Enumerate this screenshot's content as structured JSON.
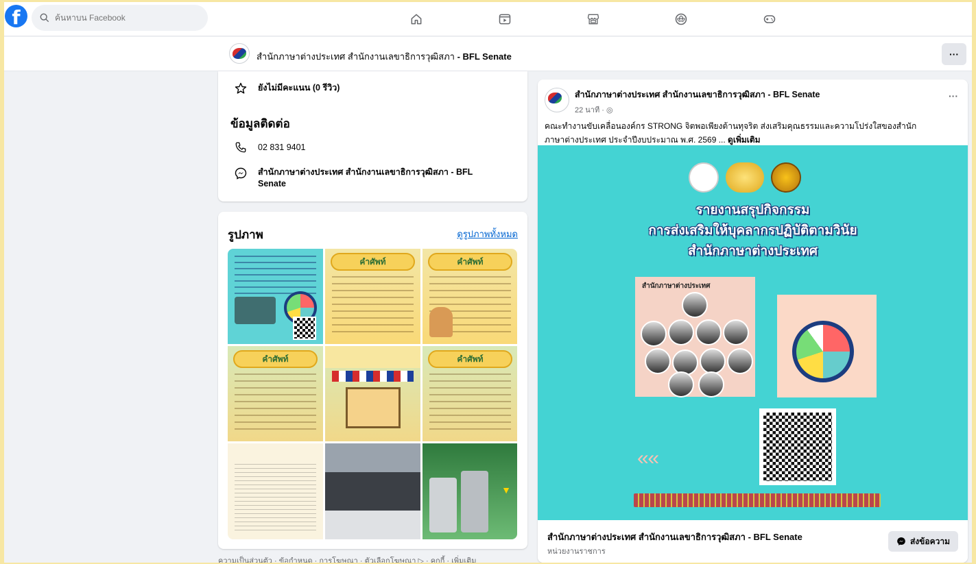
{
  "topbar": {
    "search_placeholder": "ค้นหาบน Facebook",
    "nav_icons": [
      "home-icon",
      "video-icon",
      "marketplace-icon",
      "groups-icon",
      "gaming-icon"
    ]
  },
  "pagebar": {
    "title_thai": "สำนักภาษาต่างประเทศ สำนักงานเลขาธิการวุฒิสภา",
    "title_en": " - BFL Senate",
    "more_label": "···"
  },
  "info": {
    "rating": "ยังไม่มีคะแนน (0 รีวิว)",
    "contact_title": "ข้อมูลติดต่อ",
    "phone": "02 831 9401",
    "messenger_line1": "สำนักภาษาต่างประเทศ สำนักงานเลขาธิการวุฒิสภา - BFL",
    "messenger_line2": "Senate"
  },
  "photos": {
    "title": "รูปภาพ",
    "see_all": "ดูรูปภาพทั้งหมด",
    "tile_banner": "คำศัพท์"
  },
  "footer_links": "ความเป็นส่วนตัว · ข้อกำหนด · การโฆษณา · ตัวเลือกโฆษณา ▷ · คุกกี้ · เพิ่มเติม",
  "post": {
    "author": "สำนักภาษาต่างประเทศ สำนักงานเลขาธิการวุฒิสภา - BFL Senate",
    "time": "22 นาที · ",
    "more_label": "···",
    "text_line1": "คณะทำงานขับเคลื่อนองค์กร STRONG จิตพอเพียงต้านทุจริต ส่งเสริมคุณธรรมและความโปร่งใสของสำนัก",
    "text_line2": "ภาษาต่างประเทศ ประจำปีงบประมาณ พ.ศ. 2569 ... ",
    "see_more": "ดูเพิ่มเติม",
    "image_title_1": "รายงานสรุปกิจกรรม",
    "image_title_2": "การส่งเสริมให้บุคลากรปฏิบัติตามวินัย",
    "image_title_3": "สำนักภาษาต่างประเทศ",
    "image_box_label": "สำนักภาษาต่างประเทศ",
    "page_name": "สำนักภาษาต่างประเทศ สำนักงานเลขาธิการวุฒิสภา - BFL Senate",
    "page_type": "หน่วยงานราชการ",
    "message_button": "ส่งข้อความ"
  },
  "colors": {
    "facebook_blue": "#1877f2",
    "link_blue": "#0064d1",
    "post_image_bg": "#44d3d3",
    "frame_bg": "#f7e7a3"
  }
}
